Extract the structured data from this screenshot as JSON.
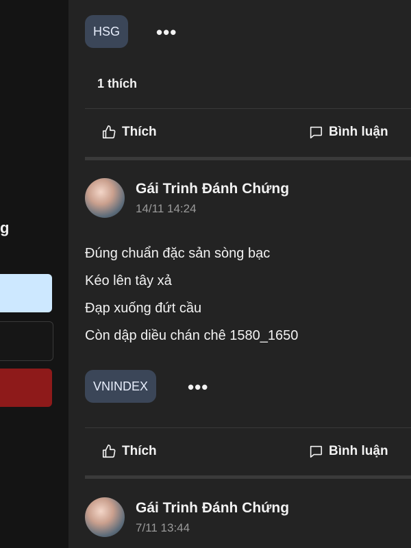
{
  "sidebar": {
    "partial_text": "g"
  },
  "posts": [
    {
      "tag": "HSG",
      "likes_text": "1 thích",
      "actions": {
        "like": "Thích",
        "comment": "Bình luận"
      }
    },
    {
      "author": "Gái Trinh Đánh Chứng",
      "time": "14/11 14:24",
      "body": [
        "Đúng chuẩn đặc sản sòng bạc",
        "Kéo lên tây xả",
        "Đạp xuống đứt cầu",
        "Còn dập diều chán chê 1580_1650"
      ],
      "tag": "VNINDEX",
      "actions": {
        "like": "Thích",
        "comment": "Bình luận"
      }
    },
    {
      "author": "Gái Trinh Đánh Chứng",
      "time": "7/11 13:44"
    }
  ],
  "icons": {
    "more": "more-dots-icon",
    "like": "thumbs-up-icon",
    "comment": "comment-bubble-icon"
  },
  "colors": {
    "background": "#232323",
    "sidebar": "#141414",
    "tag_bg": "#3b4658",
    "time_text": "#9a9a9a",
    "sidebar_light_button": "#cde8ff",
    "sidebar_red_button": "#8e1a1a"
  }
}
